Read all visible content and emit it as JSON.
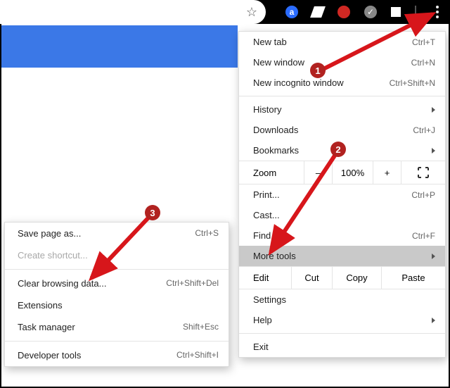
{
  "toolbar": {
    "star": "☆",
    "ext_a_letter": "a",
    "ext_check": "✓"
  },
  "menu": {
    "new_tab": {
      "label": "New tab",
      "shortcut": "Ctrl+T"
    },
    "new_window": {
      "label": "New window",
      "shortcut": "Ctrl+N"
    },
    "new_incognito": {
      "label": "New incognito window",
      "shortcut": "Ctrl+Shift+N"
    },
    "history": {
      "label": "History"
    },
    "downloads": {
      "label": "Downloads",
      "shortcut": "Ctrl+J"
    },
    "bookmarks": {
      "label": "Bookmarks"
    },
    "zoom": {
      "label": "Zoom",
      "minus": "–",
      "value": "100%",
      "plus": "+"
    },
    "print": {
      "label": "Print...",
      "shortcut": "Ctrl+P"
    },
    "cast": {
      "label": "Cast..."
    },
    "find": {
      "label": "Find...",
      "shortcut": "Ctrl+F"
    },
    "more_tools": {
      "label": "More tools"
    },
    "edit": {
      "label": "Edit",
      "cut": "Cut",
      "copy": "Copy",
      "paste": "Paste"
    },
    "settings": {
      "label": "Settings"
    },
    "help": {
      "label": "Help"
    },
    "exit": {
      "label": "Exit"
    }
  },
  "submenu": {
    "save_as": {
      "label": "Save page as...",
      "shortcut": "Ctrl+S"
    },
    "create_shortcut": {
      "label": "Create shortcut..."
    },
    "clear_data": {
      "label": "Clear browsing data...",
      "shortcut": "Ctrl+Shift+Del"
    },
    "extensions": {
      "label": "Extensions"
    },
    "task_manager": {
      "label": "Task manager",
      "shortcut": "Shift+Esc"
    },
    "developer": {
      "label": "Developer tools",
      "shortcut": "Ctrl+Shift+I"
    }
  },
  "annotations": {
    "b1": "1",
    "b2": "2",
    "b3": "3"
  }
}
